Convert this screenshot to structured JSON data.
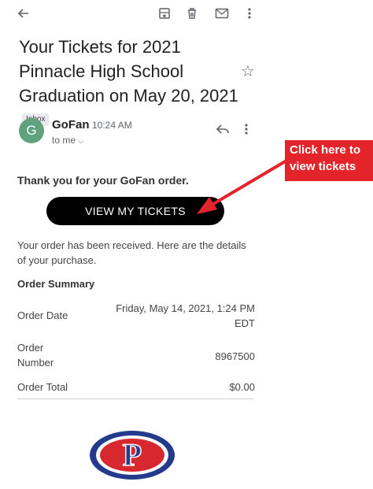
{
  "toolbar": {
    "icons": [
      "back-arrow-icon",
      "archive-icon",
      "delete-icon",
      "mark-unread-icon",
      "more-vert-icon"
    ]
  },
  "email": {
    "subject": "Your Tickets for 2021 Pinnacle High School Graduation on May 20, 2021",
    "label": "Inbox",
    "sender_initial": "G",
    "sender": "GoFan",
    "time": "10:24 AM",
    "recipient": "to me",
    "greeting": "Thank you for your GoFan order.",
    "cta_label": "VIEW MY TICKETS",
    "received_text": "Your order has been received. Here are the details of your purchase.",
    "summary_title": "Order Summary",
    "order": [
      {
        "label": "Order Date",
        "value": "Friday, May 14, 2021, 1:24 PM EDT"
      },
      {
        "label": "Order Number",
        "value": "8967500"
      },
      {
        "label": "Order Total",
        "value": "$0.00"
      }
    ],
    "logo_letter": "P"
  },
  "annotation": {
    "text": "Click here to view tickets"
  },
  "colors": {
    "accent_red": "#e3242b",
    "button_black": "#000000",
    "avatar_green": "#5fa37c",
    "logo_blue": "#243a8c",
    "logo_red": "#d7282f"
  }
}
